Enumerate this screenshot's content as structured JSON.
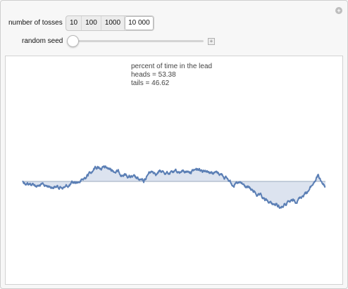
{
  "controls": {
    "tosses_label": "number of tosses",
    "tosses_options": [
      "10",
      "100",
      "1000",
      "10 000"
    ],
    "tosses_selected": "10 000",
    "seed_label": "random seed",
    "seed_fraction": 0.03
  },
  "plot": {
    "annotation_title": "percent of time in the lead",
    "heads_line": "heads = 53.38",
    "tails_line": "tails = 46.62"
  },
  "colors": {
    "walk_line": "#5b7fb5",
    "walk_fill": "#dce3ef",
    "baseline": "#9aa8bd"
  }
}
